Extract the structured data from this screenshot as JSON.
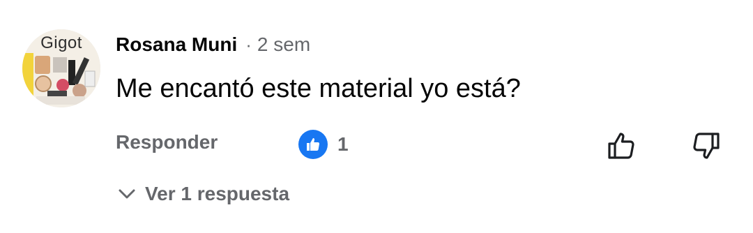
{
  "comment": {
    "avatar_label": "Gigot",
    "author": "Rosana Muni",
    "separator": "·",
    "time": "2 sem",
    "text": "Me encantó este material yo está?",
    "reply_label": "Responder",
    "reaction_count": "1",
    "reaction_type": "like",
    "reaction_color": "#1877f2",
    "view_replies_label": "Ver 1 respuesta"
  },
  "icons": {
    "reaction": "like-thumb-icon",
    "like": "thumbs-up-outline-icon",
    "dislike": "thumbs-down-outline-icon",
    "replies_toggle": "chevron-down-icon"
  },
  "colors": {
    "primary_text": "#050505",
    "secondary_text": "#65676b",
    "accent": "#1877f2"
  }
}
